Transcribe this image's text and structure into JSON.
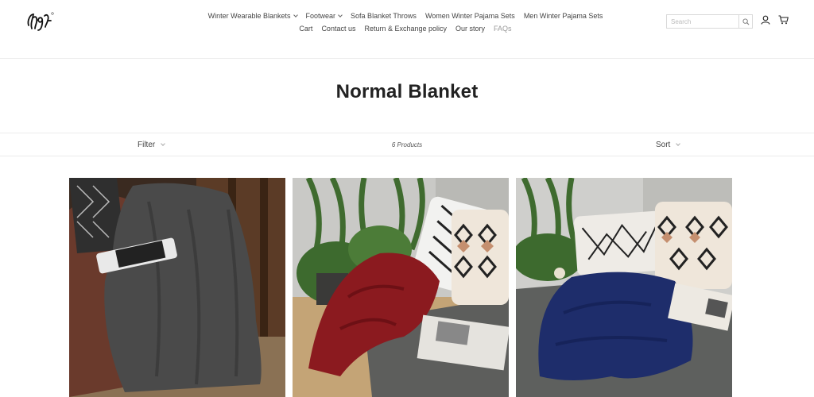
{
  "brand": {
    "logo_text": "Ingl"
  },
  "nav": {
    "row1": [
      {
        "label": "Winter Wearable Blankets",
        "dropdown": true
      },
      {
        "label": "Footwear",
        "dropdown": true
      },
      {
        "label": "Sofa Blanket Throws",
        "dropdown": false
      },
      {
        "label": "Women Winter Pajama Sets",
        "dropdown": false
      },
      {
        "label": "Men Winter Pajama Sets",
        "dropdown": false
      }
    ],
    "row2": [
      {
        "label": "Cart"
      },
      {
        "label": "Contact us"
      },
      {
        "label": "Return & Exchange policy"
      },
      {
        "label": "Our story"
      },
      {
        "label": "FAQs"
      }
    ]
  },
  "search": {
    "placeholder": "Search"
  },
  "icons": {
    "search": "search-icon",
    "account": "user-icon",
    "cart": "cart-icon"
  },
  "collection": {
    "title": "Normal Blanket"
  },
  "toolbar": {
    "filter_label": "Filter",
    "product_count": "6 Products",
    "sort_label": "Sort"
  },
  "products": [
    {
      "image": "grey-blanket-on-armchair",
      "color": "#4a4a4a"
    },
    {
      "image": "red-blanket-on-sofa",
      "color": "#8b1a1f"
    },
    {
      "image": "navy-blanket-on-sofa",
      "color": "#1e2d6b"
    }
  ]
}
